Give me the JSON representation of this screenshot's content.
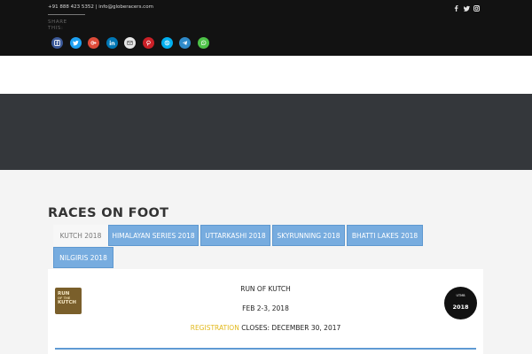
{
  "topbar": {
    "contact": "+91 888 423 5352 | info@globeracers.com",
    "share_label": "SHARE THIS:",
    "share_buttons": [
      {
        "name": "facebook",
        "color": "#3b5998"
      },
      {
        "name": "twitter",
        "color": "#1da1f2"
      },
      {
        "name": "google-plus",
        "color": "#dd4b39"
      },
      {
        "name": "linkedin",
        "color": "#0077b5"
      },
      {
        "name": "email",
        "color": "#e6e6e6"
      },
      {
        "name": "pinterest",
        "color": "#cb2027"
      },
      {
        "name": "skype",
        "color": "#00aff0"
      },
      {
        "name": "telegram",
        "color": "#2f8ac9"
      },
      {
        "name": "whatsapp",
        "color": "#4dc247"
      }
    ],
    "top_icons": [
      "facebook-icon",
      "twitter-icon",
      "instagram-icon"
    ]
  },
  "section": {
    "title": "RACES ON FOOT",
    "tabs": [
      {
        "label": "KUTCH 2018",
        "active": true
      },
      {
        "label": "HIMALAYAN SERIES 2018",
        "active": false
      },
      {
        "label": "UTTARKASHI 2018",
        "active": false
      },
      {
        "label": "SKYRUNNING 2018",
        "active": false
      },
      {
        "label": "BHATTI LAKES 2018",
        "active": false
      },
      {
        "label": "NILGIRIS 2018",
        "active": false
      }
    ]
  },
  "race": {
    "name": "RUN OF KUTCH",
    "date": "FEB 2-3, 2018",
    "registration_highlight": "REGISTRATION",
    "registration_rest": " CLOSES: DECEMBER 30, 2017",
    "logo_left": {
      "line1": "RUN",
      "line2": "OF THE",
      "line3": "KUTCH"
    },
    "logo_right": {
      "top": "UTMB",
      "bottom": "2018"
    }
  },
  "colors": {
    "accent_blue": "#77acdf",
    "highlight_yellow": "#e2b91c",
    "topbar": "#121212",
    "band": "#34373b"
  }
}
